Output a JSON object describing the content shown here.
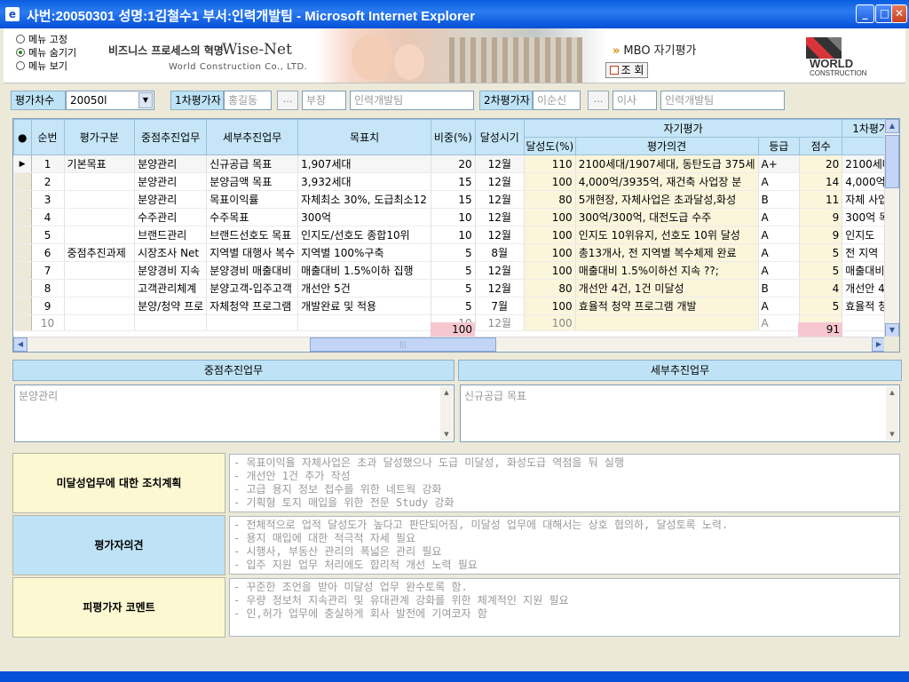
{
  "window": {
    "title": "사번:20050301 성명:1김철수1 부서:인력개발팀 - Microsoft Internet Explorer",
    "minimize": "_",
    "maximize": "□",
    "close": "✕"
  },
  "banner": {
    "menu_options": [
      "메뉴 고정",
      "메뉴 숨기기",
      "메뉴 보기"
    ],
    "menu_selected": 1,
    "slogan": "비즈니스 프로세스의 혁명",
    "brand": "Wise-Net",
    "company": "World Construction Co., LTD.",
    "mbo_title": "MBO 자기평가",
    "query_button": "조 회",
    "logo_text": "WORLD",
    "logo_sub": "CONSTRUCTION"
  },
  "evalbar": {
    "round_label": "평가차수",
    "round_value": "20050l",
    "first_label": "1차평가자",
    "first_name": "홍길동",
    "first_rank": "부장",
    "first_dept": "인력개발팀",
    "second_label": "2차평가자",
    "second_name": "이순신",
    "second_rank": "이사",
    "second_dept": "인력개발팀",
    "dots": "…"
  },
  "grid": {
    "headers": {
      "seq": "순번",
      "category": "평가구분",
      "key_task": "중점추진업무",
      "detail_task": "세부추진업무",
      "target": "목표치",
      "weight": "비중(%)",
      "period": "달성시기",
      "self_eval": "자기평가",
      "achieve": "달성도(%)",
      "opinion": "평가의견",
      "grade": "등급",
      "score": "점수",
      "first_eval": "1차평가"
    },
    "rows": [
      {
        "seq": "1",
        "category": "기본목표",
        "key": "분양관리",
        "detail": "신규공급 목표",
        "target": "1,907세대",
        "weight": "20",
        "period": "12월",
        "achieve": "110",
        "opinion": "2100세대/1907세대, 동탄도급 375세",
        "grade": "A+",
        "score": "20",
        "first": "2100세대"
      },
      {
        "seq": "2",
        "category": "",
        "key": "분양관리",
        "detail": "분양금액 목표",
        "target": "3,932세대",
        "weight": "15",
        "period": "12월",
        "achieve": "100",
        "opinion": "4,000억/3935억, 재건축 사업장 분",
        "grade": "A",
        "score": "14",
        "first": "4,000억/"
      },
      {
        "seq": "3",
        "category": "",
        "key": "분양관리",
        "detail": "목표이익률",
        "target": "자체최소 30%, 도급최소12",
        "weight": "15",
        "period": "12월",
        "achieve": "80",
        "opinion": "5개현장, 자체사업은 초과달성,화성",
        "grade": "B",
        "score": "11",
        "first": "자체 사업"
      },
      {
        "seq": "4",
        "category": "",
        "key": "수주관리",
        "detail": "수주목표",
        "target": "300억",
        "weight": "10",
        "period": "12월",
        "achieve": "100",
        "opinion": "300억/300억, 대전도급 수주",
        "grade": "A",
        "score": "9",
        "first": "300억 목"
      },
      {
        "seq": "5",
        "category": "",
        "key": "브랜드관리",
        "detail": "브랜드선호도 목표",
        "target": "인지도/선호도 종합10위",
        "weight": "10",
        "period": "12월",
        "achieve": "100",
        "opinion": "인지도 10위유지, 선호도 10위 달성",
        "grade": "A",
        "score": "9",
        "first": "인지도"
      },
      {
        "seq": "6",
        "category": "중점추진과제",
        "key": "시장조사 Net",
        "detail": "지역별 대행사 복수",
        "target": "지역별 100%구축",
        "weight": "5",
        "period": "8월",
        "achieve": "100",
        "opinion": "총13개사, 전 지역별 복수체제 완료",
        "grade": "A",
        "score": "5",
        "first": "전 지역"
      },
      {
        "seq": "7",
        "category": "",
        "key": "분양경비 지속",
        "detail": "분양경비 매출대비",
        "target": "매출대비 1.5%이하 집행",
        "weight": "5",
        "period": "12월",
        "achieve": "100",
        "opinion": "매출대비 1.5%이하선 지속 ??;",
        "grade": "A",
        "score": "5",
        "first": "매출대비"
      },
      {
        "seq": "8",
        "category": "",
        "key": "고객관리체계",
        "detail": "분양고객-입주고객",
        "target": "개선안 5건",
        "weight": "5",
        "period": "12월",
        "achieve": "80",
        "opinion": "개선안 4건, 1건 미달성",
        "grade": "B",
        "score": "4",
        "first": "개선안 4"
      },
      {
        "seq": "9",
        "category": "",
        "key": "분양/청약 프로",
        "detail": "자체청약 프로그램",
        "target": "개발완료 및 적용",
        "weight": "5",
        "period": "7월",
        "achieve": "100",
        "opinion": "효율적 청약 프로그램 개발",
        "grade": "A",
        "score": "5",
        "first": "효율적 청"
      },
      {
        "seq": "10",
        "category": "",
        "key": "",
        "detail": "",
        "target": "",
        "weight": "10",
        "period": "12월",
        "achieve": "100",
        "opinion": "",
        "grade": "A",
        "score": "",
        "first": ""
      }
    ],
    "total_weight": "100",
    "total_score": "91"
  },
  "detail": {
    "key_header": "중점추진업무",
    "detail_header": "세부추진업무",
    "key_value": "분양관리",
    "detail_value": "신규공급 목표"
  },
  "comments": [
    {
      "label": "미달성업무에 대한 조치계획",
      "bg": "#fbf8d2",
      "lines": [
        "- 목표이익율 자체사업은 초과 달성했으나 도급 미달성, 화성도급 역점을 둬 실행",
        "- 개선안 1건 추가 작성",
        "- 고급 용지 정보 접수를 위한 네트웍 강화",
        "- 기획형 토지 매입을 위한 전문 Study 강화"
      ]
    },
    {
      "label": "평가자의견",
      "bg": "#bfe3f6",
      "lines": [
        "- 전체적으로 업적 달성도가 높다고 판단되어짐, 미달성 업무에 대해서는 상호 협의하, 달성토록 노력.",
        "- 용지 매입에 대한 적극적 자세 필요",
        "- 시행사, 부동산 관리의 폭넓은 관리 필요",
        "- 입주 지원 업무 처리에도 합리적 개선 노력 필요"
      ]
    },
    {
      "label": "피평가자 코멘트",
      "bg": "#fbf8d2",
      "lines": [
        "- 꾸준한 조언을 받아 미달성 업무 완수토록 함.",
        "- 우량 정보처 지속관리 및 유대관계 강화를 위한 체계적인 지원 필요",
        "- 인,허가 업무에 충실하게 회사 발전에 기여코자 함"
      ]
    }
  ],
  "colors": {
    "header_blue": "#bfe3f6",
    "label_yellow": "#fbf8d2",
    "total_pink": "#f7c7cf",
    "titlebar": "#0a5ddf"
  }
}
